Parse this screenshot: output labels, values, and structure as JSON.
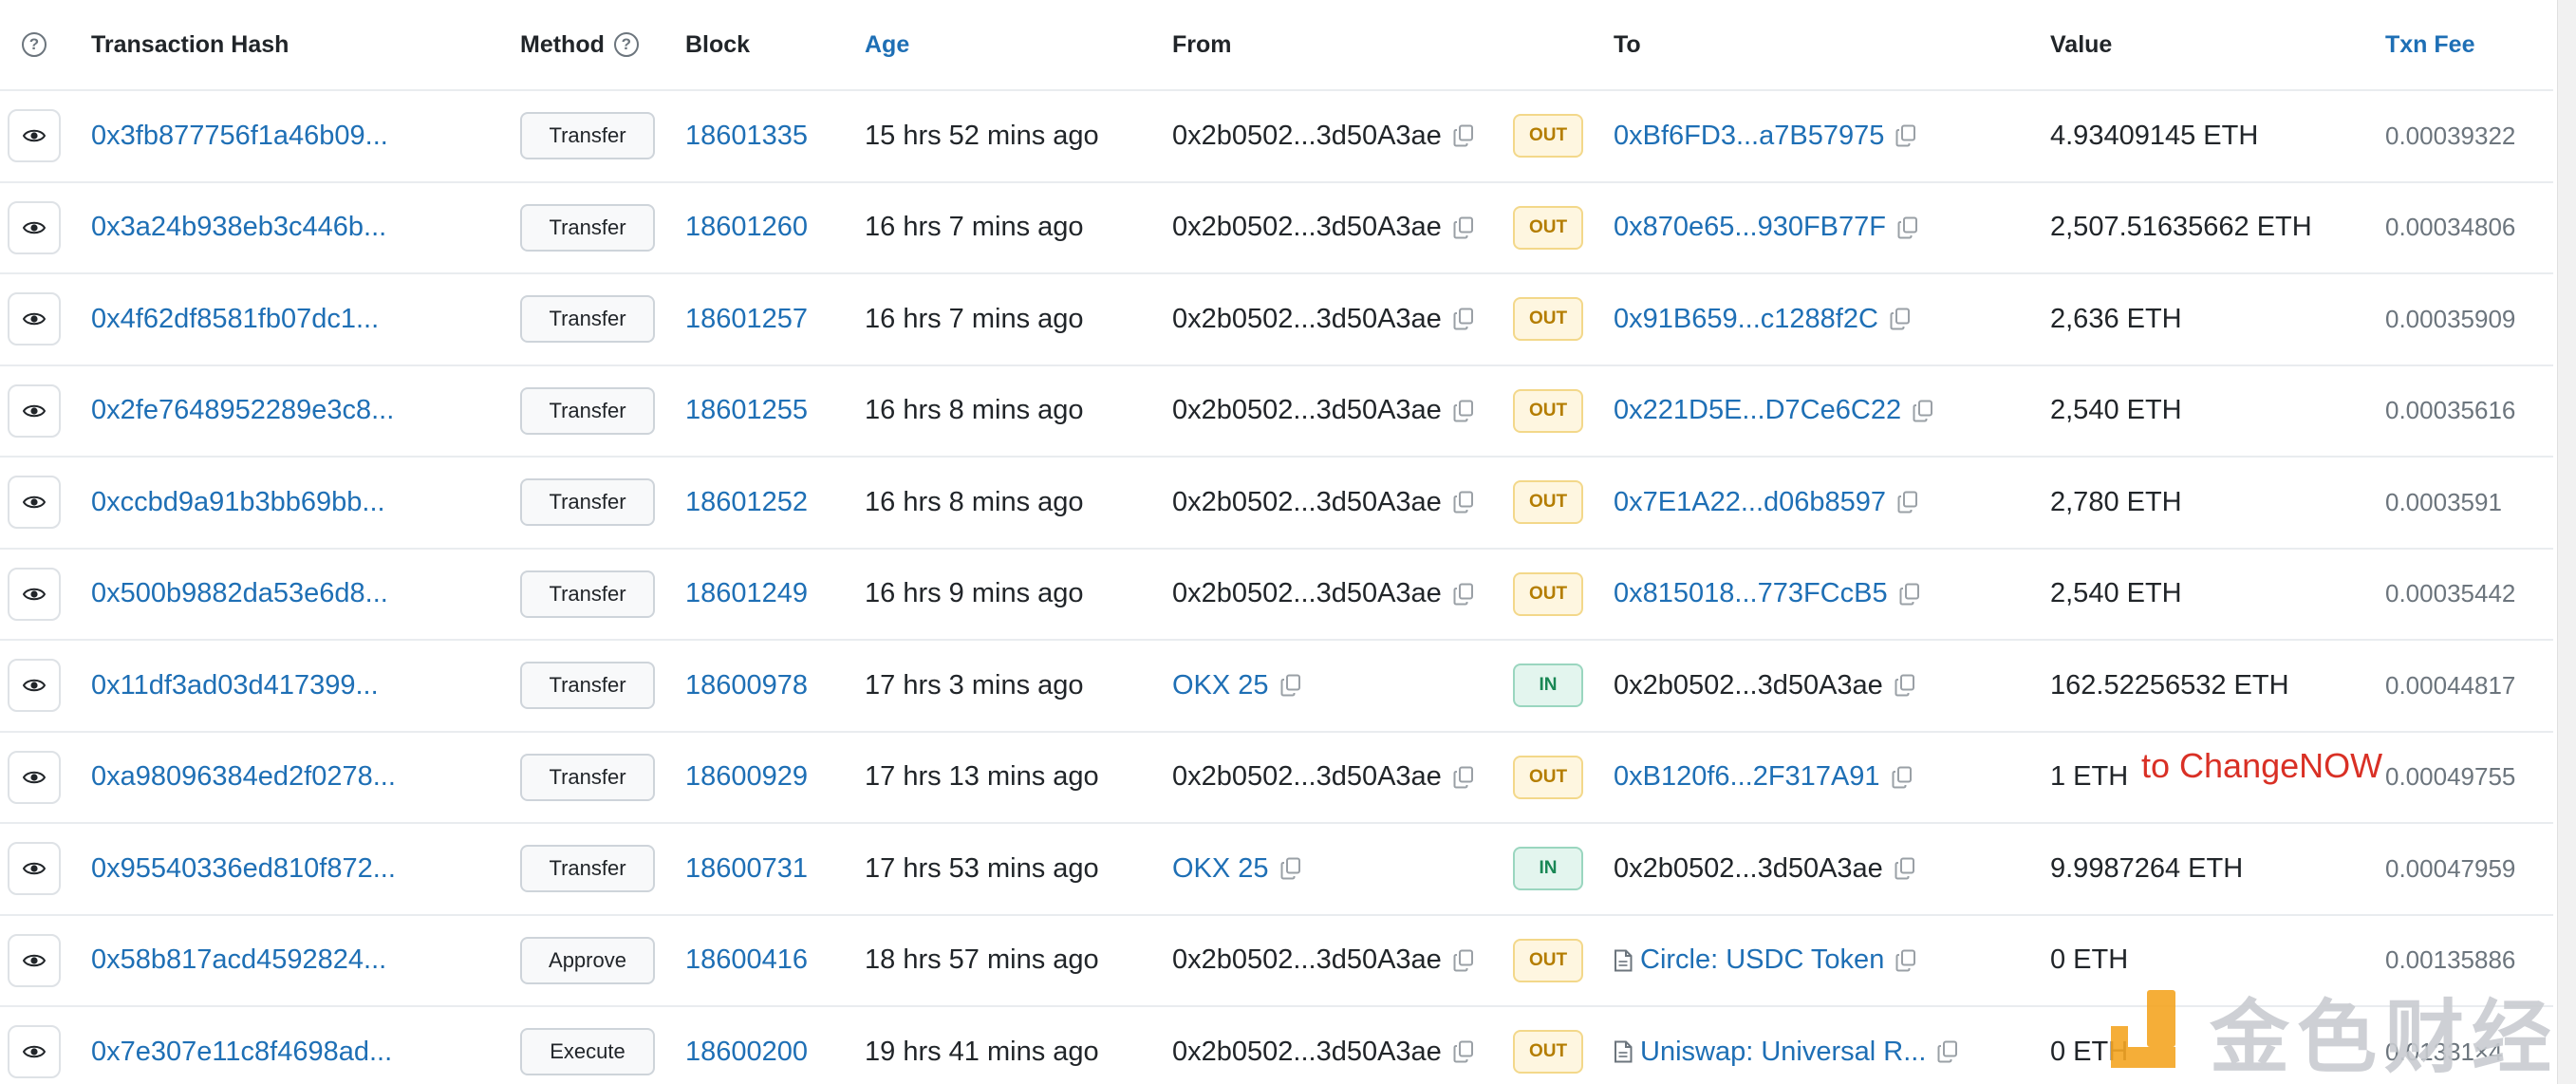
{
  "header": {
    "hash": "Transaction Hash",
    "method": "Method",
    "block": "Block",
    "age": "Age",
    "from": "From",
    "to": "To",
    "value": "Value",
    "fee": "Txn Fee"
  },
  "rows": [
    {
      "hash": "0x3fb877756f1a46b09...",
      "method": "Transfer",
      "block": "18601335",
      "age": "15 hrs 52 mins ago",
      "from": "0x2b0502...3d50A3ae",
      "from_link": false,
      "dir": "OUT",
      "to": "0xBf6FD3...a7B57975",
      "to_link": true,
      "to_contract": false,
      "value": "4.93409145 ETH",
      "fee": "0.00039322"
    },
    {
      "hash": "0x3a24b938eb3c446b...",
      "method": "Transfer",
      "block": "18601260",
      "age": "16 hrs 7 mins ago",
      "from": "0x2b0502...3d50A3ae",
      "from_link": false,
      "dir": "OUT",
      "to": "0x870e65...930FB77F",
      "to_link": true,
      "to_contract": false,
      "value": "2,507.51635662 ETH",
      "fee": "0.00034806"
    },
    {
      "hash": "0x4f62df8581fb07dc1...",
      "method": "Transfer",
      "block": "18601257",
      "age": "16 hrs 7 mins ago",
      "from": "0x2b0502...3d50A3ae",
      "from_link": false,
      "dir": "OUT",
      "to": "0x91B659...c1288f2C",
      "to_link": true,
      "to_contract": false,
      "value": "2,636 ETH",
      "fee": "0.00035909"
    },
    {
      "hash": "0x2fe7648952289e3c8...",
      "method": "Transfer",
      "block": "18601255",
      "age": "16 hrs 8 mins ago",
      "from": "0x2b0502...3d50A3ae",
      "from_link": false,
      "dir": "OUT",
      "to": "0x221D5E...D7Ce6C22",
      "to_link": true,
      "to_contract": false,
      "value": "2,540 ETH",
      "fee": "0.00035616"
    },
    {
      "hash": "0xccbd9a91b3bb69bb...",
      "method": "Transfer",
      "block": "18601252",
      "age": "16 hrs 8 mins ago",
      "from": "0x2b0502...3d50A3ae",
      "from_link": false,
      "dir": "OUT",
      "to": "0x7E1A22...d06b8597",
      "to_link": true,
      "to_contract": false,
      "value": "2,780 ETH",
      "fee": "0.0003591"
    },
    {
      "hash": "0x500b9882da53e6d8...",
      "method": "Transfer",
      "block": "18601249",
      "age": "16 hrs 9 mins ago",
      "from": "0x2b0502...3d50A3ae",
      "from_link": false,
      "dir": "OUT",
      "to": "0x815018...773FCcB5",
      "to_link": true,
      "to_contract": false,
      "value": "2,540 ETH",
      "fee": "0.00035442"
    },
    {
      "hash": "0x11df3ad03d417399...",
      "method": "Transfer",
      "block": "18600978",
      "age": "17 hrs 3 mins ago",
      "from": "OKX 25",
      "from_link": true,
      "dir": "IN",
      "to": "0x2b0502...3d50A3ae",
      "to_link": false,
      "to_contract": false,
      "value": "162.52256532 ETH",
      "fee": "0.00044817"
    },
    {
      "hash": "0xa98096384ed2f0278...",
      "method": "Transfer",
      "block": "18600929",
      "age": "17 hrs 13 mins ago",
      "from": "0x2b0502...3d50A3ae",
      "from_link": false,
      "dir": "OUT",
      "to": "0xB120f6...2F317A91",
      "to_link": true,
      "to_contract": false,
      "value": "1 ETH",
      "fee": "0.00049755"
    },
    {
      "hash": "0x95540336ed810f872...",
      "method": "Transfer",
      "block": "18600731",
      "age": "17 hrs 53 mins ago",
      "from": "OKX 25",
      "from_link": true,
      "dir": "IN",
      "to": "0x2b0502...3d50A3ae",
      "to_link": false,
      "to_contract": false,
      "value": "9.9987264 ETH",
      "fee": "0.00047959"
    },
    {
      "hash": "0x58b817acd4592824...",
      "method": "Approve",
      "block": "18600416",
      "age": "18 hrs 57 mins ago",
      "from": "0x2b0502...3d50A3ae",
      "from_link": false,
      "dir": "OUT",
      "to": "Circle: USDC Token",
      "to_link": true,
      "to_contract": true,
      "value": "0 ETH",
      "fee": "0.00135886"
    },
    {
      "hash": "0x7e307e11c8f4698ad...",
      "method": "Execute",
      "block": "18600200",
      "age": "19 hrs 41 mins ago",
      "from": "0x2b0502...3d50A3ae",
      "from_link": false,
      "dir": "OUT",
      "to": "Uniswap: Universal R...",
      "to_link": true,
      "to_contract": true,
      "value": "0 ETH",
      "fee": "0.01331×4"
    }
  ],
  "annotation": "to ChangeNOW",
  "watermark": {
    "text": "金色财经"
  },
  "icons": {
    "help": "question-circle-icon",
    "view": "eye-icon",
    "copy": "copy-icon",
    "contract": "file-contract-icon"
  },
  "colors": {
    "link": "#1e6fb5",
    "out_bg": "#fef6e0",
    "in_bg": "#e3f5ee",
    "annotation": "#d93025"
  }
}
